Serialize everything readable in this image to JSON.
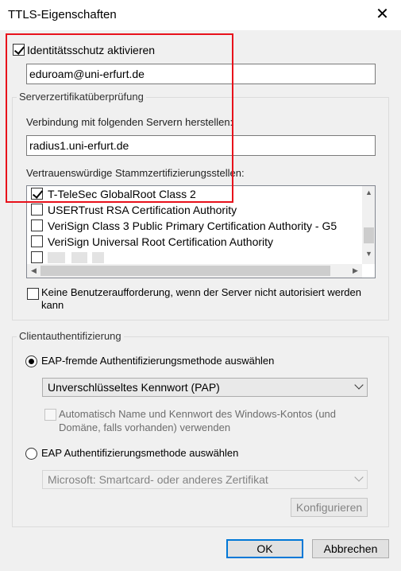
{
  "window": {
    "title": "TTLS-Eigenschaften",
    "close_glyph": "✕"
  },
  "identity": {
    "label": "Identitätsschutz aktivieren",
    "checked": true,
    "value": "eduroam@uni-erfurt.de"
  },
  "server_group": {
    "title": "Serverzertifikatüberprüfung",
    "connect_label": "Verbindung mit folgenden Servern herstellen:",
    "server_value": "radius1.uni-erfurt.de",
    "ca_label": "Vertrauenswürdige Stammzertifizierungsstellen:",
    "ca_list": [
      {
        "label": "T-TeleSec GlobalRoot Class 2",
        "checked": true
      },
      {
        "label": "USERTrust RSA Certification Authority",
        "checked": false
      },
      {
        "label": "VeriSign Class 3 Public Primary Certification Authority - G5",
        "checked": false
      },
      {
        "label": "VeriSign Universal Root Certification Authority",
        "checked": false
      },
      {
        "label": "",
        "checked": false
      }
    ],
    "no_prompt_label": "Keine Benutzeraufforderung, wenn der Server nicht autorisiert werden kann"
  },
  "client_group": {
    "title": "Clientauthentifizierung",
    "radio1_label": "EAP-fremde Authentifizierungsmethode auswählen",
    "combo1_value": "Unverschlüsseltes Kennwort (PAP)",
    "auto_label": "Automatisch Name und Kennwort des Windows-Kontos (und Domäne, falls vorhanden) verwenden",
    "radio2_label": "EAP Authentifizierungsmethode auswählen",
    "combo2_value": "Microsoft: Smartcard- oder anderes Zertifikat",
    "configure_label": "Konfigurieren"
  },
  "buttons": {
    "ok": "OK",
    "cancel": "Abbrechen"
  },
  "colors": {
    "highlight_box": "#e8111b",
    "default_button_border": "#0078d7"
  }
}
